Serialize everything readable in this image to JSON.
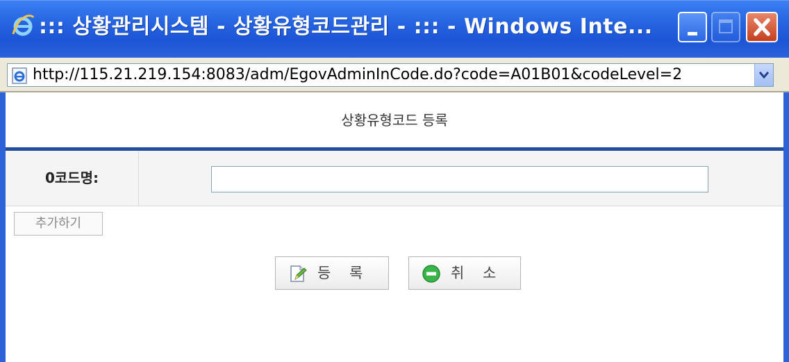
{
  "window": {
    "title": "::: 상황관리시스템 - 상황유형코드관리 - ::: - Windows Inte...",
    "address_url": "http://115.21.219.154:8083/adm/EgovAdminInCode.do?code=A01B01&codeLevel=2"
  },
  "page": {
    "title": "상황유형코드 등록"
  },
  "form": {
    "code_name_label": "0코드명:",
    "code_name_value": "",
    "add_button_label": "추가하기"
  },
  "actions": {
    "register_label": "등 록",
    "cancel_label": "취 소"
  },
  "icons": {
    "browser": "ie-logo-icon",
    "page": "ie-page-icon",
    "register": "edit-document-icon",
    "cancel": "minus-circle-icon"
  },
  "colors": {
    "titlebar": "#2563e0",
    "close_button": "#c4401f",
    "section_rule": "#1f4f9c",
    "cancel_icon": "#3ab54a"
  }
}
